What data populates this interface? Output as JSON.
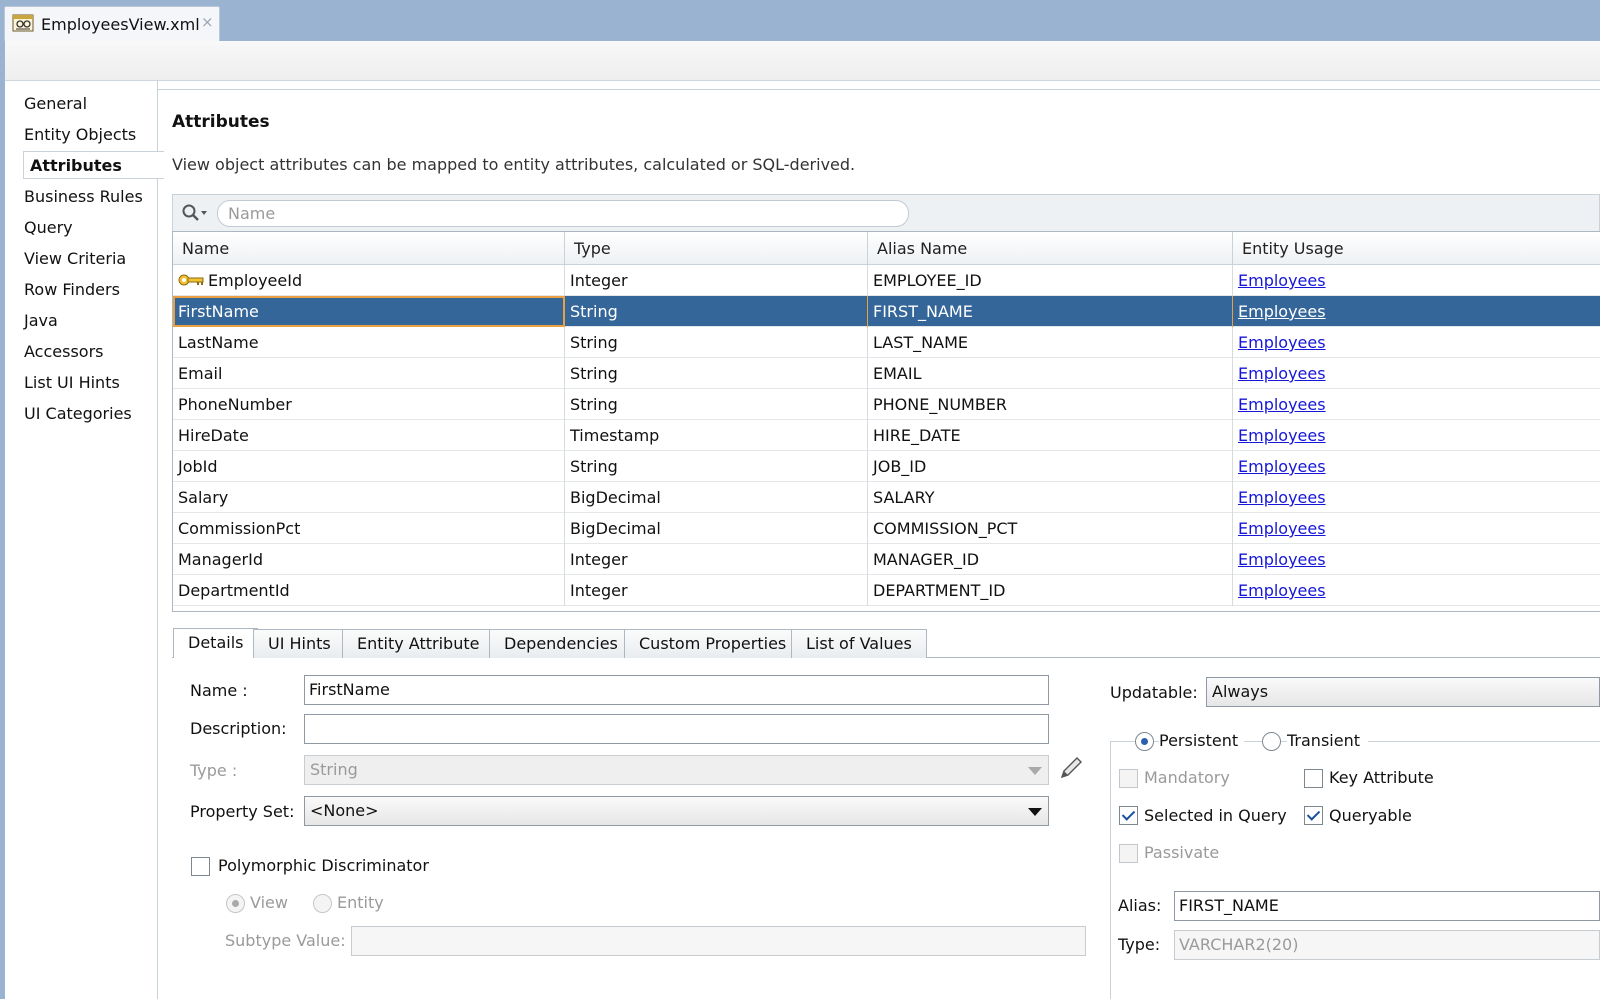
{
  "editor_tab": {
    "title": "EmployeesView.xml",
    "close": "×"
  },
  "nav": {
    "items": [
      "General",
      "Entity Objects",
      "Attributes",
      "Business Rules",
      "Query",
      "View Criteria",
      "Row Finders",
      "Java",
      "Accessors",
      "List UI Hints",
      "UI Categories"
    ],
    "active": "Attributes"
  },
  "section": {
    "title": "Attributes",
    "description": "View object attributes can be mapped to entity attributes, calculated or SQL-derived."
  },
  "search": {
    "placeholder": "Name",
    "value": ""
  },
  "table": {
    "columns": [
      "Name",
      "Type",
      "Alias Name",
      "Entity Usage"
    ],
    "rows": [
      {
        "name": "EmployeeId",
        "type": "Integer",
        "alias": "EMPLOYEE_ID",
        "usage": "Employees",
        "key": true
      },
      {
        "name": "FirstName",
        "type": "String",
        "alias": "FIRST_NAME",
        "usage": "Employees",
        "selected": true
      },
      {
        "name": "LastName",
        "type": "String",
        "alias": "LAST_NAME",
        "usage": "Employees"
      },
      {
        "name": "Email",
        "type": "String",
        "alias": "EMAIL",
        "usage": "Employees"
      },
      {
        "name": "PhoneNumber",
        "type": "String",
        "alias": "PHONE_NUMBER",
        "usage": "Employees"
      },
      {
        "name": "HireDate",
        "type": "Timestamp",
        "alias": "HIRE_DATE",
        "usage": "Employees"
      },
      {
        "name": "JobId",
        "type": "String",
        "alias": "JOB_ID",
        "usage": "Employees"
      },
      {
        "name": "Salary",
        "type": "BigDecimal",
        "alias": "SALARY",
        "usage": "Employees"
      },
      {
        "name": "CommissionPct",
        "type": "BigDecimal",
        "alias": "COMMISSION_PCT",
        "usage": "Employees"
      },
      {
        "name": "ManagerId",
        "type": "Integer",
        "alias": "MANAGER_ID",
        "usage": "Employees"
      },
      {
        "name": "DepartmentId",
        "type": "Integer",
        "alias": "DEPARTMENT_ID",
        "usage": "Employees"
      }
    ]
  },
  "detail_tabs": {
    "items": [
      "Details",
      "UI Hints",
      "Entity Attribute",
      "Dependencies",
      "Custom Properties",
      "List of Values"
    ],
    "active": "Details"
  },
  "details": {
    "name_label": "Name :",
    "name_value": "FirstName",
    "description_label": "Description:",
    "description_value": "",
    "type_label": "Type :",
    "type_value": "String",
    "property_set_label": "Property Set:",
    "property_set_value": "<None>",
    "polymorphic_label": "Polymorphic Discriminator",
    "polymorphic_checked": false,
    "view_label": "View",
    "entity_label": "Entity",
    "subtype_label": "Subtype Value:",
    "subtype_value": "",
    "updatable_label": "Updatable:",
    "updatable_value": "Always",
    "persistent_label": "Persistent",
    "transient_label": "Transient",
    "mandatory_label": "Mandatory",
    "key_attribute_label": "Key Attribute",
    "selected_in_query_label": "Selected in Query",
    "queryable_label": "Queryable",
    "passivate_label": "Passivate",
    "alias_label": "Alias:",
    "alias_value": "FIRST_NAME",
    "sql_type_label": "Type:",
    "sql_type_value": "VARCHAR2(20)"
  },
  "colors": {
    "title_bar": "#9ab3d0",
    "selection": "#35669a",
    "selection_border": "#eaa040",
    "link": "#1616d8"
  }
}
